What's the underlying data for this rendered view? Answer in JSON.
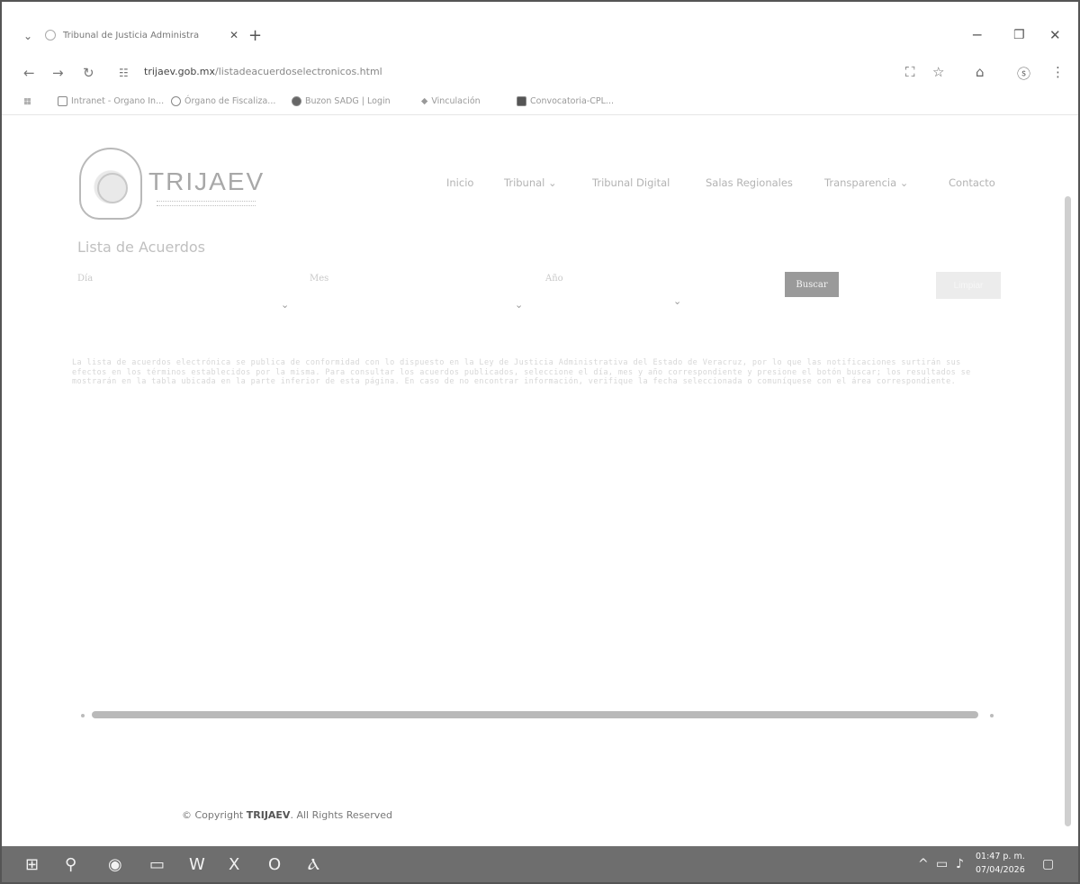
{
  "browser": {
    "tab_title": "Tribunal de Justicia Administra",
    "tab_close": "✕",
    "new_tab": "+",
    "url_domain": "trijaev.gob.mx",
    "url_path": "/listadeacuerdoselectronicos.html",
    "bookmarks": [
      "Intranet - Organo In...",
      "Órgano de Fiscaliza...",
      "Buzon SADG | Login",
      "Vinculación",
      "Convocatoria-CPL..."
    ]
  },
  "site": {
    "brand": "TRIJAEV",
    "menu": [
      "Inicio",
      "Tribunal ⌄",
      "Tribunal Digital",
      "Salas Regionales",
      "Transparencia ⌄",
      "Contacto"
    ]
  },
  "main": {
    "title": "Lista de Acuerdos",
    "labels": {
      "day": "Día",
      "month": "Mes",
      "year": "Año"
    },
    "select_caret": "⌄",
    "search_button": "Buscar",
    "clear_button": "Limpiar",
    "notice": "La lista de acuerdos electrónica se publica de conformidad con lo dispuesto en la Ley de Justicia Administrativa del Estado de Veracruz, por lo que las notificaciones surtirán sus efectos en los términos establecidos por la misma. Para consultar los acuerdos publicados, seleccione el día, mes y año correspondiente y presione el botón buscar; los resultados se mostrarán en la tabla ubicada en la parte inferior de esta página. En caso de no encontrar información, verifique la fecha seleccionada o comuníquese con el área correspondiente."
  },
  "footer": {
    "prefix": "© Copyright ",
    "brand": "TRIJAEV",
    "suffix": ". All Rights Reserved"
  },
  "taskbar": {
    "time": "01:47 p. m.",
    "date": "07/04/2026"
  }
}
